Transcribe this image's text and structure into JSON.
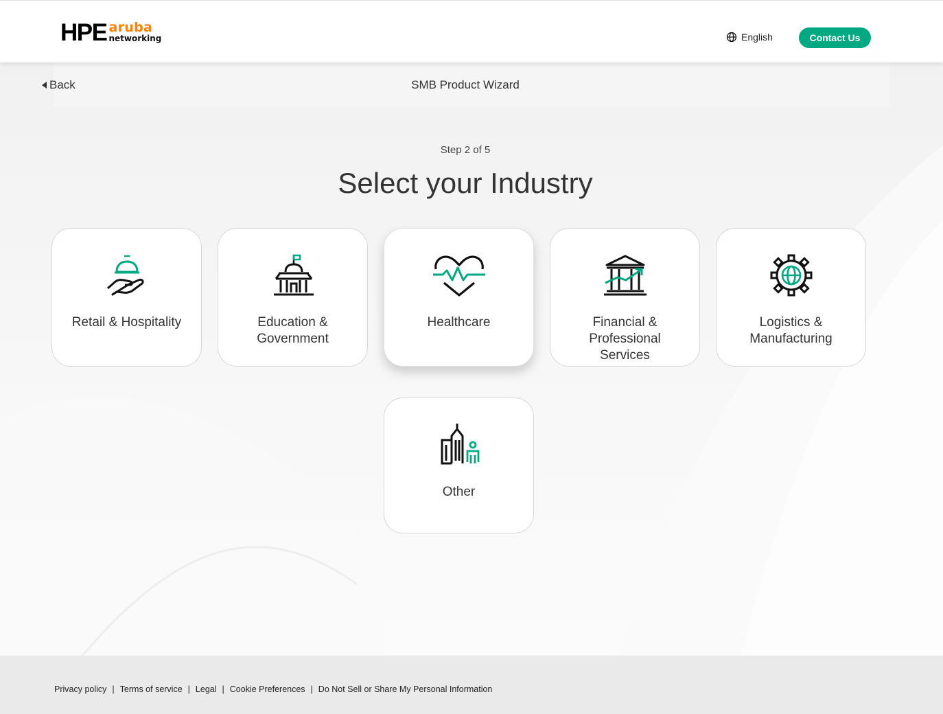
{
  "header": {
    "logo_hpe": "HPE",
    "logo_aruba": "aruba",
    "logo_networking": "networking",
    "language": "English",
    "contact_label": "Contact Us"
  },
  "nav": {
    "back_label": "Back",
    "wizard_title": "SMB Product Wizard"
  },
  "main": {
    "step": "Step 2 of 5",
    "heading": "Select your Industry",
    "industries": [
      {
        "label": "Retail & Hospitality",
        "icon": "service-bell-hand-icon"
      },
      {
        "label": "Education & Government",
        "icon": "government-building-icon"
      },
      {
        "label": "Healthcare",
        "icon": "heartbeat-icon"
      },
      {
        "label": "Financial & Professional Services",
        "icon": "bank-growth-icon"
      },
      {
        "label": "Logistics & Manufacturing",
        "icon": "globe-gear-icon"
      },
      {
        "label": "Other",
        "icon": "city-person-icon"
      }
    ]
  },
  "footer": {
    "links": [
      "Privacy policy",
      "Terms of service",
      "Legal",
      "Cookie Preferences",
      "Do Not Sell or Share My Personal Information"
    ]
  },
  "colors": {
    "accent": "#01a982",
    "brand_orange": "#ff8300"
  }
}
